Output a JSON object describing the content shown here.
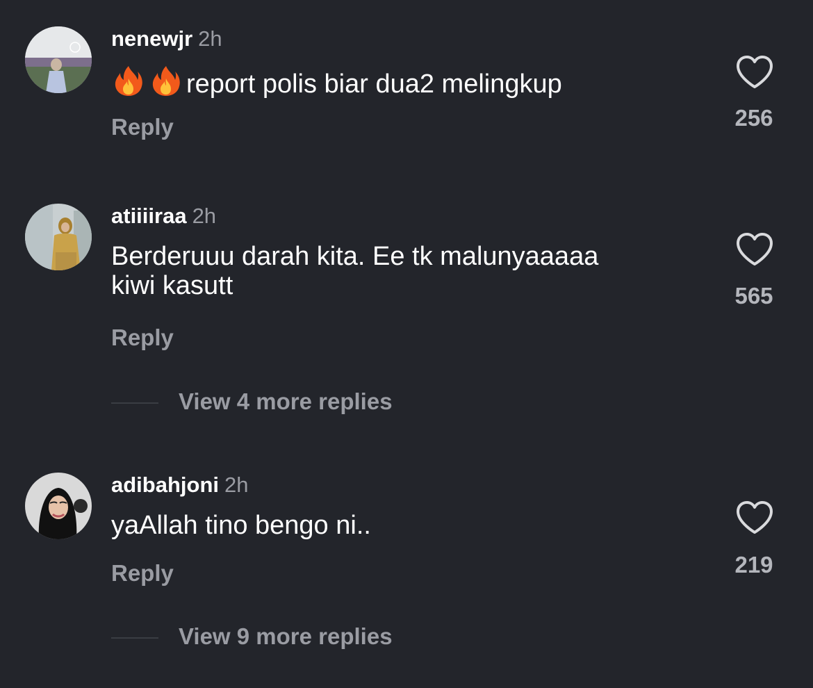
{
  "comments": [
    {
      "username": "nenewjr",
      "time": "2h",
      "text": "report polis biar dua2 melingkup",
      "emoji": "🔥🔥",
      "reply_label": "Reply",
      "likes": "256"
    },
    {
      "username": "atiiiiraa",
      "time": "2h",
      "text_line1": "Berderuuu darah kita. Ee tk malunyaaaaa",
      "text_line2": "kiwi kasutt",
      "reply_label": "Reply",
      "likes": "565",
      "view_replies": "View 4 more replies"
    },
    {
      "username": "adibahjoni",
      "time": "2h",
      "text": "yaAllah tino bengo ni..",
      "reply_label": "Reply",
      "likes": "219",
      "view_replies": "View 9 more replies"
    }
  ],
  "colors": {
    "background": "#23252b",
    "primary_text": "#ffffff",
    "secondary_text": "#9a9ca3"
  },
  "icons": {
    "like": "heart-outline-icon",
    "emoji": "fire-emoji"
  }
}
